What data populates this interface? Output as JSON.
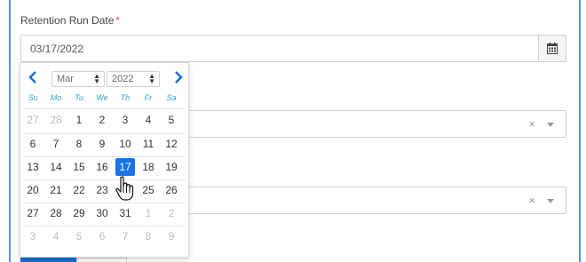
{
  "form": {
    "retention_label": "Retention Run Date",
    "required_mark": "*",
    "date_value": "03/17/2022",
    "select_clear_glyph": "×"
  },
  "datepicker": {
    "prev_glyph": "‹",
    "next_glyph": "›",
    "month": "Mar",
    "year": "2022",
    "weekdays": [
      "Su",
      "Mo",
      "Tu",
      "We",
      "Th",
      "Fr",
      "Sa"
    ],
    "weeks": [
      [
        {
          "d": "27",
          "muted": true
        },
        {
          "d": "28",
          "muted": true
        },
        {
          "d": "1"
        },
        {
          "d": "2"
        },
        {
          "d": "3"
        },
        {
          "d": "4"
        },
        {
          "d": "5"
        }
      ],
      [
        {
          "d": "6"
        },
        {
          "d": "7"
        },
        {
          "d": "8"
        },
        {
          "d": "9"
        },
        {
          "d": "10"
        },
        {
          "d": "11"
        },
        {
          "d": "12"
        }
      ],
      [
        {
          "d": "13"
        },
        {
          "d": "14"
        },
        {
          "d": "15"
        },
        {
          "d": "16"
        },
        {
          "d": "17",
          "selected": true
        },
        {
          "d": "18"
        },
        {
          "d": "19"
        }
      ],
      [
        {
          "d": "20"
        },
        {
          "d": "21"
        },
        {
          "d": "22"
        },
        {
          "d": "23"
        },
        {
          "d": "24"
        },
        {
          "d": "25"
        },
        {
          "d": "26"
        }
      ],
      [
        {
          "d": "27"
        },
        {
          "d": "28"
        },
        {
          "d": "29"
        },
        {
          "d": "30"
        },
        {
          "d": "31"
        },
        {
          "d": "1",
          "muted": true
        },
        {
          "d": "2",
          "muted": true
        }
      ],
      [
        {
          "d": "3",
          "muted": true
        },
        {
          "d": "4",
          "muted": true
        },
        {
          "d": "5",
          "muted": true
        },
        {
          "d": "6",
          "muted": true
        },
        {
          "d": "7",
          "muted": true
        },
        {
          "d": "8",
          "muted": true
        },
        {
          "d": "9",
          "muted": true
        }
      ]
    ]
  },
  "colors": {
    "accent": "#1a73e8",
    "weekday": "#2fa3c9",
    "required": "#d9534f"
  }
}
